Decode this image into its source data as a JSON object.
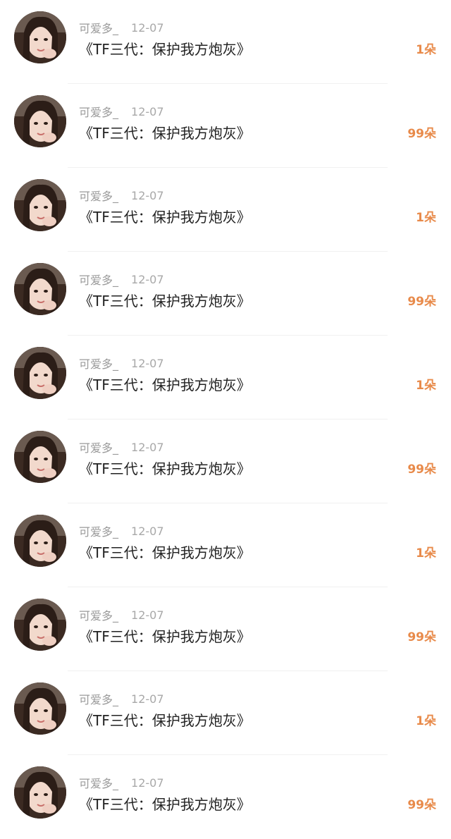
{
  "colors": {
    "accent": "#e88a4a",
    "meta_text": "#9a9a9a",
    "title_text": "#222222",
    "divider": "#f0f0f0"
  },
  "rows": [
    {
      "username": "可爱多_",
      "date": "12-07",
      "title": "《TF三代：保护我方炮灰》",
      "gift": "1朵"
    },
    {
      "username": "可爱多_",
      "date": "12-07",
      "title": "《TF三代：保护我方炮灰》",
      "gift": "99朵"
    },
    {
      "username": "可爱多_",
      "date": "12-07",
      "title": "《TF三代：保护我方炮灰》",
      "gift": "1朵"
    },
    {
      "username": "可爱多_",
      "date": "12-07",
      "title": "《TF三代：保护我方炮灰》",
      "gift": "99朵"
    },
    {
      "username": "可爱多_",
      "date": "12-07",
      "title": "《TF三代：保护我方炮灰》",
      "gift": "1朵"
    },
    {
      "username": "可爱多_",
      "date": "12-07",
      "title": "《TF三代：保护我方炮灰》",
      "gift": "99朵"
    },
    {
      "username": "可爱多_",
      "date": "12-07",
      "title": "《TF三代：保护我方炮灰》",
      "gift": "1朵"
    },
    {
      "username": "可爱多_",
      "date": "12-07",
      "title": "《TF三代：保护我方炮灰》",
      "gift": "99朵"
    },
    {
      "username": "可爱多_",
      "date": "12-07",
      "title": "《TF三代：保护我方炮灰》",
      "gift": "1朵"
    },
    {
      "username": "可爱多_",
      "date": "12-07",
      "title": "《TF三代：保护我方炮灰》",
      "gift": "99朵"
    }
  ]
}
